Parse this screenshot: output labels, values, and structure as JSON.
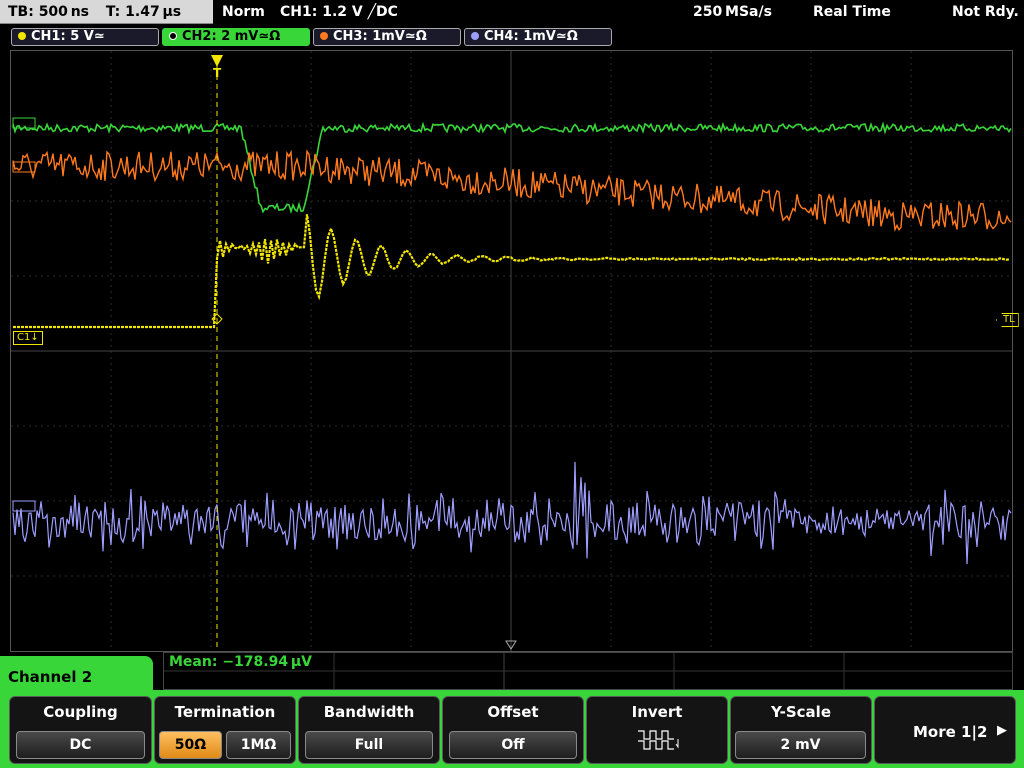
{
  "status": {
    "timebase": "TB: 500 ns",
    "trigger_time": "T: 1.47 µs",
    "mode": "Norm",
    "trigger": "CH1: 1.2 V ╱DC",
    "sample_rate": "250 MSa/s",
    "acq": "Real Time",
    "state": "Not Rdy."
  },
  "channels": [
    {
      "label": "CH1: 5 V≃",
      "color": "#f2e600"
    },
    {
      "label": "CH2: 2 mV≃Ω",
      "color": "#39d639"
    },
    {
      "label": "CH3: 1mV≃Ω",
      "color": "#ff7a1f"
    },
    {
      "label": "CH4: 1mV≃Ω",
      "color": "#9e9eff"
    }
  ],
  "markers": {
    "c1_ground": "C1↓",
    "trigger_level": "TL"
  },
  "menu": {
    "title": "Channel 2",
    "measurement": "Mean: −178.94 µV",
    "softkeys": [
      {
        "title": "Coupling",
        "value": "DC"
      },
      {
        "title": "Termination",
        "options": [
          "50Ω",
          "1MΩ"
        ],
        "selected": 0
      },
      {
        "title": "Bandwidth",
        "value": "Full"
      },
      {
        "title": "Offset",
        "value": "Off"
      },
      {
        "title": "Invert",
        "value": ""
      },
      {
        "title": "Y-Scale",
        "value": "2 mV"
      },
      {
        "title": "More 1|2",
        "value": ""
      }
    ]
  },
  "colors": {
    "accent": "#39d639",
    "ch1": "#f2e600",
    "ch2": "#39d639",
    "ch3": "#ff7a1f",
    "ch4": "#9e9eff"
  }
}
